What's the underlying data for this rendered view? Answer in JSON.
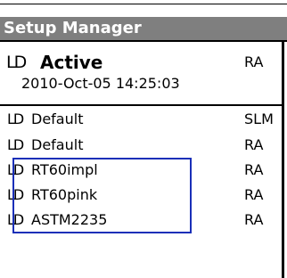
{
  "window": {
    "title": "Setup Manager"
  },
  "colors": {
    "title_bar": "#7f7f7f",
    "title_text": "#ffffff",
    "selection_outline": "#1a2fb8"
  },
  "active_setup": {
    "icon_text": "LD",
    "icon": "ld-setup-icon",
    "name": "Active",
    "mode": "RA",
    "timestamp": "2010-Oct-05 14:25:03"
  },
  "setups": [
    {
      "icon_text": "LD",
      "icon": "ld-setup-icon",
      "name": "Default",
      "mode": "SLM"
    },
    {
      "icon_text": "LD",
      "icon": "ld-setup-icon",
      "name": "Default",
      "mode": "RA"
    },
    {
      "icon_text": "LD",
      "icon": "ld-setup-icon",
      "name": "RT60impl",
      "mode": "RA",
      "selected": true
    },
    {
      "icon_text": "LD",
      "icon": "ld-setup-icon",
      "name": "RT60pink",
      "mode": "RA",
      "selected": true
    },
    {
      "icon_text": "LD",
      "icon": "ld-setup-icon",
      "name": "ASTM2235",
      "mode": "RA",
      "selected": true
    }
  ]
}
